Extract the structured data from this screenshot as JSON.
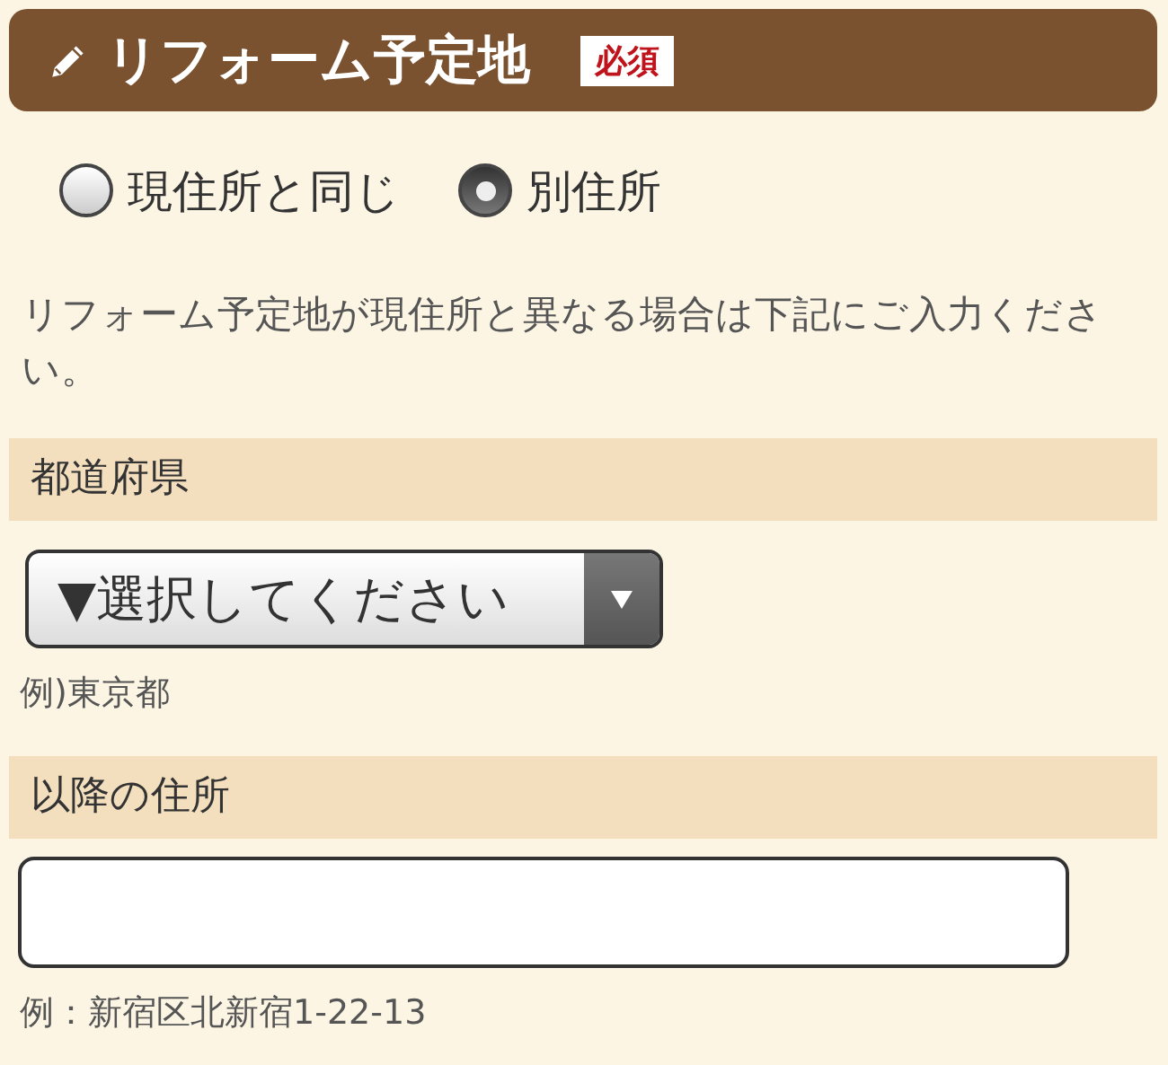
{
  "header": {
    "title": "リフォーム予定地",
    "badge": "必須"
  },
  "radios": [
    {
      "label": "現住所と同じ",
      "selected": false
    },
    {
      "label": "別住所",
      "selected": true
    }
  ],
  "description": "リフォーム予定地が現住所と異なる場合は下記にご入力ください。",
  "fields": [
    {
      "kind": "select",
      "label": "都道府県",
      "value": "▼選択してください",
      "hint": "例)東京都"
    },
    {
      "kind": "text",
      "label": "以降の住所",
      "hint": "例：新宿区北新宿1-22-13"
    }
  ]
}
